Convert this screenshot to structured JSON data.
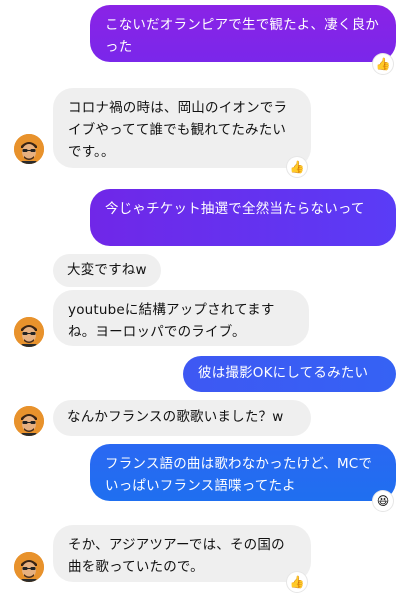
{
  "messages": [
    {
      "id": "m1",
      "side": "outgoing",
      "text": "こないだオランピアで生で観たよ、凄く良かった",
      "reaction": "👍"
    },
    {
      "id": "m2",
      "side": "incoming",
      "text": "コロナ禍の時は、岡山のイオンでライブやってて誰でも観れてたみたいです。。",
      "reaction": "👍"
    },
    {
      "id": "m3",
      "side": "outgoing",
      "text": "今じゃチケット抽選で全然当たらないって"
    },
    {
      "id": "m4",
      "side": "incoming",
      "text": "大変ですねw"
    },
    {
      "id": "m5",
      "side": "incoming",
      "text": "youtubeに結構アップされてますね。ヨーロッパでのライブ。"
    },
    {
      "id": "m6",
      "side": "outgoing",
      "text": "彼は撮影OKにしてるみたい"
    },
    {
      "id": "m7",
      "side": "incoming",
      "text": "なんかフランスの歌歌いました？w"
    },
    {
      "id": "m8",
      "side": "outgoing",
      "text": "フランス語の曲は歌わなかったけど、MCでいっぱいフランス語喋ってたよ",
      "reaction": "😆"
    },
    {
      "id": "m9",
      "side": "incoming",
      "text": "そか、アジアツアーでは、その国の曲を歌っていたので。",
      "reaction": "👍"
    }
  ],
  "colors": {
    "incoming_bg": "#efefef",
    "outgoing_purple": "#7b25e6",
    "outgoing_violet": "#6a2cf2",
    "outgoing_indigo": "#3d5cf5",
    "outgoing_blue": "#1f6ff0"
  },
  "icons": {
    "avatar": "contact-avatar-icon",
    "thumbs_up": "thumbs-up-icon",
    "laugh": "laughing-face-icon"
  }
}
